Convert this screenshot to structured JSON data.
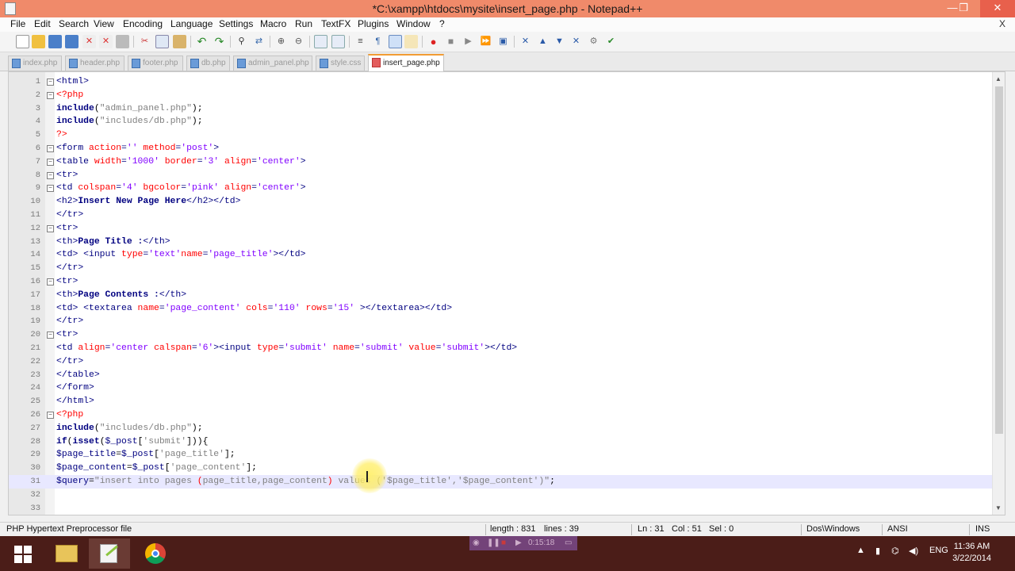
{
  "window": {
    "title": "*C:\\xampp\\htdocs\\mysite\\insert_page.php - Notepad++",
    "minimize": "—",
    "restore": "❐",
    "close": "✕"
  },
  "menu": {
    "items": [
      "File",
      "Edit",
      "Search",
      "View",
      "Encoding",
      "Language",
      "Settings",
      "Macro",
      "Run",
      "TextFX",
      "Plugins",
      "Window",
      "?"
    ],
    "close_label": "X"
  },
  "tabs": [
    {
      "label": "index.php",
      "active": false
    },
    {
      "label": "header.php",
      "active": false
    },
    {
      "label": "footer.php",
      "active": false
    },
    {
      "label": "db.php",
      "active": false
    },
    {
      "label": "admin_panel.php",
      "active": false
    },
    {
      "label": "style.css",
      "active": false
    },
    {
      "label": "insert_page.php",
      "active": true
    }
  ],
  "editor": {
    "current_line": 31,
    "lines": [
      {
        "n": "1",
        "fold": "−",
        "segs": [
          [
            "t",
            "<html>"
          ]
        ]
      },
      {
        "n": "2",
        "fold": "−",
        "segs": [
          [
            "p",
            "<?php"
          ]
        ]
      },
      {
        "n": "3",
        "fold": "",
        "segs": [
          [
            "k",
            "include"
          ],
          [
            "w",
            "("
          ],
          [
            "s",
            "\"admin_panel.php\""
          ],
          [
            "w",
            ");"
          ]
        ]
      },
      {
        "n": "4",
        "fold": "",
        "segs": [
          [
            "k",
            "include"
          ],
          [
            "w",
            "("
          ],
          [
            "s",
            "\"includes/db.php\""
          ],
          [
            "w",
            ");"
          ]
        ]
      },
      {
        "n": "5",
        "fold": "",
        "segs": [
          [
            "p",
            "?>"
          ]
        ]
      },
      {
        "n": "6",
        "fold": "−",
        "segs": [
          [
            "t",
            "<form "
          ],
          [
            "a",
            "action"
          ],
          [
            "t",
            "="
          ],
          [
            "v",
            "''"
          ],
          [
            "t",
            " "
          ],
          [
            "a",
            "method"
          ],
          [
            "t",
            "="
          ],
          [
            "v",
            "'post'"
          ],
          [
            "t",
            ">"
          ]
        ]
      },
      {
        "n": "7",
        "fold": "−",
        "segs": [
          [
            "t",
            "<table "
          ],
          [
            "a",
            "width"
          ],
          [
            "t",
            "="
          ],
          [
            "v",
            "'1000'"
          ],
          [
            "t",
            " "
          ],
          [
            "a",
            "border"
          ],
          [
            "t",
            "="
          ],
          [
            "v",
            "'3'"
          ],
          [
            "t",
            " "
          ],
          [
            "a",
            "align"
          ],
          [
            "t",
            "="
          ],
          [
            "v",
            "'center'"
          ],
          [
            "t",
            ">"
          ]
        ]
      },
      {
        "n": "8",
        "fold": "−",
        "segs": [
          [
            "t",
            "<tr>"
          ]
        ]
      },
      {
        "n": "9",
        "fold": "−",
        "segs": [
          [
            "t",
            "<td "
          ],
          [
            "a",
            "colspan"
          ],
          [
            "t",
            "="
          ],
          [
            "v",
            "'4'"
          ],
          [
            "t",
            " "
          ],
          [
            "a",
            "bgcolor"
          ],
          [
            "t",
            "="
          ],
          [
            "v",
            "'pink'"
          ],
          [
            "t",
            " "
          ],
          [
            "a",
            "align"
          ],
          [
            "t",
            "="
          ],
          [
            "v",
            "'center'"
          ],
          [
            "t",
            ">"
          ]
        ]
      },
      {
        "n": "10",
        "fold": "",
        "segs": [
          [
            "t",
            "<h2>"
          ],
          [
            "k",
            "Insert New Page Here"
          ],
          [
            "t",
            "</h2></td>"
          ]
        ]
      },
      {
        "n": "11",
        "fold": "",
        "segs": [
          [
            "t",
            "</tr>"
          ]
        ]
      },
      {
        "n": "12",
        "fold": "−",
        "segs": [
          [
            "t",
            "<tr>"
          ]
        ]
      },
      {
        "n": "13",
        "fold": "",
        "segs": [
          [
            "t",
            "<th>"
          ],
          [
            "k",
            "Page Title :"
          ],
          [
            "t",
            "</th>"
          ]
        ]
      },
      {
        "n": "14",
        "fold": "",
        "segs": [
          [
            "t",
            "<td> <input "
          ],
          [
            "a",
            "type"
          ],
          [
            "t",
            "="
          ],
          [
            "v",
            "'text'"
          ],
          [
            "a",
            "name"
          ],
          [
            "t",
            "="
          ],
          [
            "v",
            "'page_title'"
          ],
          [
            "t",
            "></td>"
          ]
        ]
      },
      {
        "n": "15",
        "fold": "",
        "segs": [
          [
            "t",
            "</tr>"
          ]
        ]
      },
      {
        "n": "16",
        "fold": "−",
        "segs": [
          [
            "t",
            "<tr>"
          ]
        ]
      },
      {
        "n": "17",
        "fold": "",
        "segs": [
          [
            "t",
            "<th>"
          ],
          [
            "k",
            "Page Contents :"
          ],
          [
            "t",
            "</th>"
          ]
        ]
      },
      {
        "n": "18",
        "fold": "",
        "segs": [
          [
            "t",
            "<td> <textarea "
          ],
          [
            "a",
            "name"
          ],
          [
            "t",
            "="
          ],
          [
            "v",
            "'page_content'"
          ],
          [
            "t",
            " "
          ],
          [
            "a",
            "cols"
          ],
          [
            "t",
            "="
          ],
          [
            "v",
            "'110'"
          ],
          [
            "t",
            " "
          ],
          [
            "a",
            "rows"
          ],
          [
            "t",
            "="
          ],
          [
            "v",
            "'15'"
          ],
          [
            "t",
            " ></textarea></td>"
          ]
        ]
      },
      {
        "n": "19",
        "fold": "",
        "segs": [
          [
            "t",
            "</tr>"
          ]
        ]
      },
      {
        "n": "20",
        "fold": "−",
        "segs": [
          [
            "t",
            "<tr>"
          ]
        ]
      },
      {
        "n": "21",
        "fold": "",
        "segs": [
          [
            "t",
            "<td "
          ],
          [
            "a",
            "align"
          ],
          [
            "t",
            "="
          ],
          [
            "v",
            "'center "
          ],
          [
            "a",
            "calspan"
          ],
          [
            "t",
            "="
          ],
          [
            "v",
            "'6'"
          ],
          [
            "t",
            "><input "
          ],
          [
            "a",
            "type"
          ],
          [
            "t",
            "="
          ],
          [
            "v",
            "'submit'"
          ],
          [
            "t",
            " "
          ],
          [
            "a",
            "name"
          ],
          [
            "t",
            "="
          ],
          [
            "v",
            "'submit'"
          ],
          [
            "t",
            " "
          ],
          [
            "a",
            "value"
          ],
          [
            "t",
            "="
          ],
          [
            "v",
            "'submit'"
          ],
          [
            "t",
            "></td>"
          ]
        ]
      },
      {
        "n": "22",
        "fold": "",
        "segs": [
          [
            "t",
            "</tr>"
          ]
        ]
      },
      {
        "n": "23",
        "fold": "",
        "segs": [
          [
            "t",
            "</table>"
          ]
        ]
      },
      {
        "n": "24",
        "fold": "",
        "segs": [
          [
            "t",
            "</form>"
          ]
        ]
      },
      {
        "n": "25",
        "fold": "",
        "segs": [
          [
            "t",
            "</html>"
          ]
        ]
      },
      {
        "n": "26",
        "fold": "−",
        "segs": [
          [
            "p",
            "<?php"
          ]
        ]
      },
      {
        "n": "27",
        "fold": "",
        "segs": [
          [
            "k",
            "include"
          ],
          [
            "w",
            "("
          ],
          [
            "s",
            "\"includes/db.php\""
          ],
          [
            "w",
            ");"
          ]
        ]
      },
      {
        "n": "28",
        "fold": "",
        "segs": [
          [
            "k",
            "if"
          ],
          [
            "w",
            "("
          ],
          [
            "k",
            "isset"
          ],
          [
            "w",
            "("
          ],
          [
            "var",
            "$_post"
          ],
          [
            "w",
            "["
          ],
          [
            "s",
            "'submit'"
          ],
          [
            "w",
            "])){"
          ]
        ]
      },
      {
        "n": "29",
        "fold": "",
        "segs": [
          [
            "var",
            "$page_title"
          ],
          [
            "w",
            "="
          ],
          [
            "var",
            "$_post"
          ],
          [
            "w",
            "["
          ],
          [
            "s",
            "'page_title'"
          ],
          [
            "w",
            "];"
          ]
        ]
      },
      {
        "n": "30",
        "fold": "",
        "segs": [
          [
            "var",
            "$page_content"
          ],
          [
            "w",
            "="
          ],
          [
            "var",
            "$_post"
          ],
          [
            "w",
            "["
          ],
          [
            "s",
            "'page_content'"
          ],
          [
            "w",
            "];"
          ]
        ]
      },
      {
        "n": "31",
        "fold": "",
        "segs": [
          [
            "var",
            "$query"
          ],
          [
            "w",
            "="
          ],
          [
            "s",
            "\"insert into pages "
          ],
          [
            "p",
            "("
          ],
          [
            "s",
            "page_title,page_content"
          ],
          [
            "p",
            ")"
          ],
          [
            "s",
            " values ('$page_title','$page_content')\""
          ],
          [
            "w",
            ";"
          ]
        ]
      },
      {
        "n": "32",
        "fold": "",
        "segs": []
      },
      {
        "n": "33",
        "fold": "",
        "segs": []
      }
    ]
  },
  "status": {
    "file_type": "PHP Hypertext Preprocessor file",
    "length": "length : 831",
    "lines": "lines : 39",
    "ln": "Ln : 31",
    "col": "Col : 51",
    "sel": "Sel : 0",
    "eol": "Dos\\Windows",
    "encoding": "ANSI",
    "mode": "INS"
  },
  "recorder": {
    "time": "0:15:18"
  },
  "taskbar": {
    "language": "ENG",
    "time": "11:36 AM",
    "date": "3/22/2014"
  },
  "colors": {
    "title_bar": "#f08a6a",
    "taskbar": "#4b1d18",
    "active_tab_accent": "#f29c34",
    "current_line": "#e8e8ff"
  },
  "toolbar": {
    "icons": [
      "new-file-icon",
      "open-file-icon",
      "save-icon",
      "save-all-icon",
      "close-icon",
      "close-all-icon",
      "print-icon",
      "cut-icon",
      "copy-icon",
      "paste-icon",
      "undo-icon",
      "redo-icon",
      "find-icon",
      "replace-icon",
      "zoom-in-icon",
      "zoom-out-icon",
      "sync-v-icon",
      "sync-h-icon",
      "word-wrap-icon",
      "show-all-chars-icon",
      "indent-guide-icon",
      "doc-map-icon",
      "record-macro-icon",
      "stop-macro-icon",
      "play-macro-icon",
      "play-multiple-icon",
      "save-macro-icon",
      "bookmark-icon",
      "up-icon",
      "down-icon",
      "trim-icon",
      "launch-icon",
      "spell-icon"
    ]
  }
}
